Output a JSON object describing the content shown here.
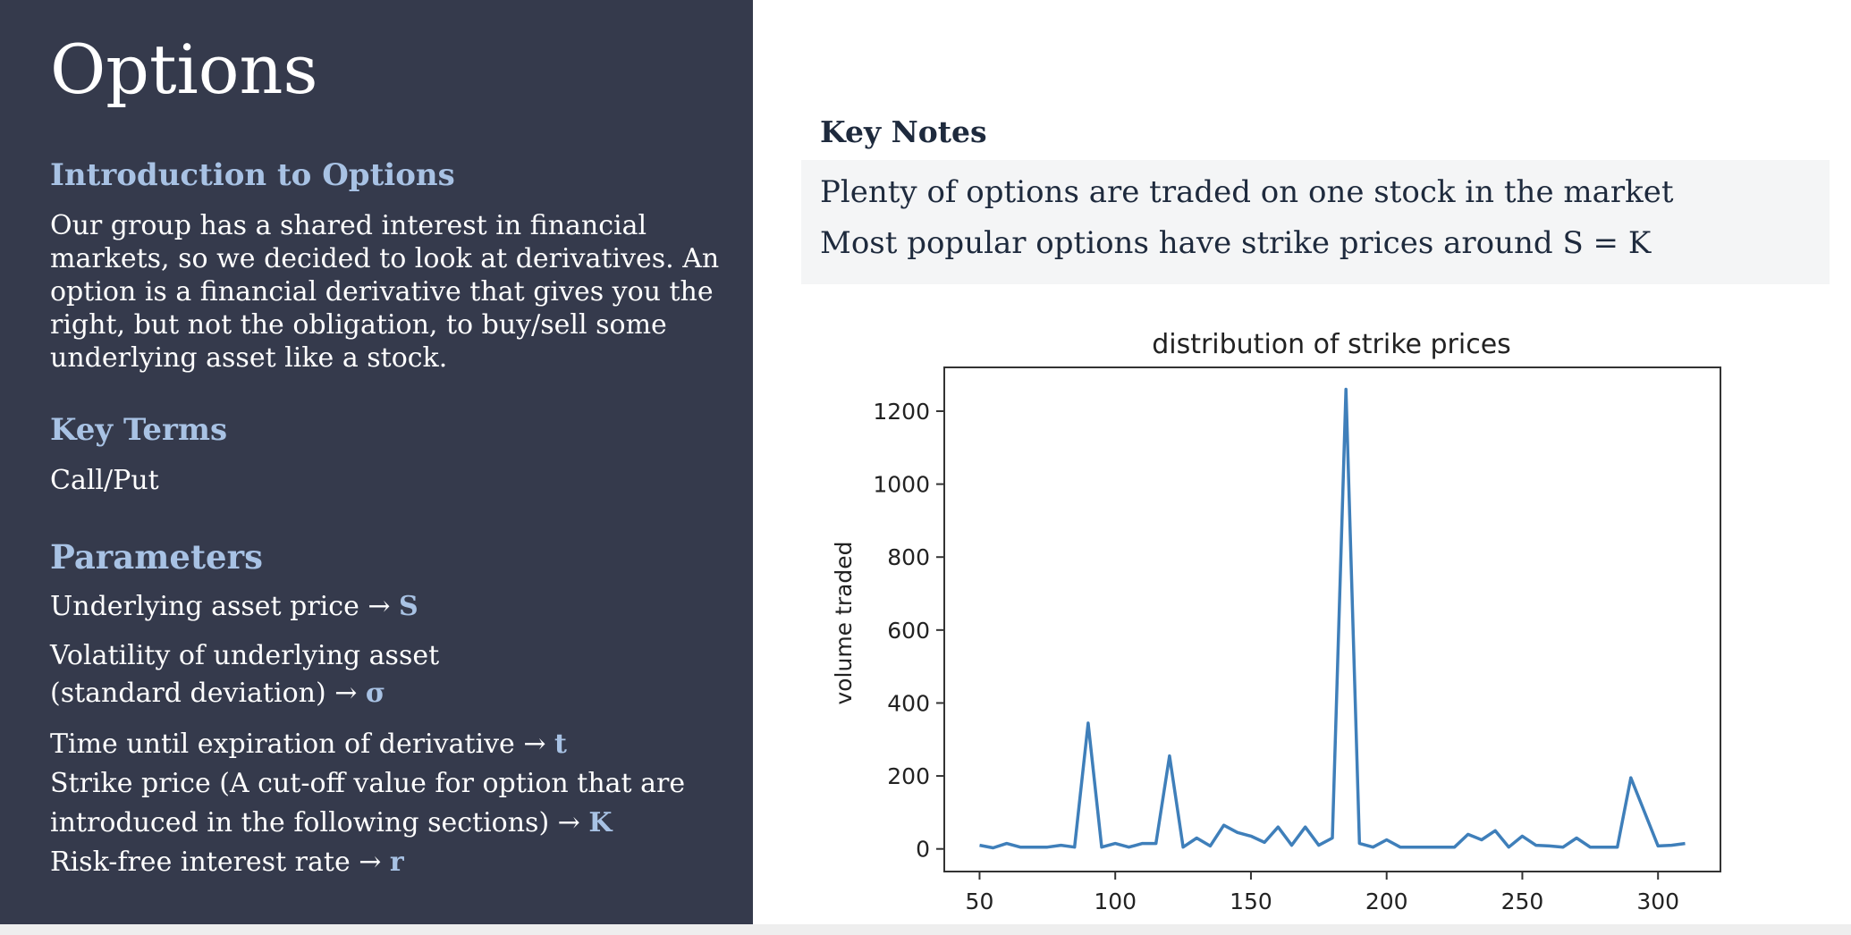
{
  "sidebar": {
    "title": "Options",
    "intro_heading": "Introduction to Options",
    "intro_lines": [
      "Our group has a shared interest in financial",
      "markets, so we decided to look at derivatives. An",
      "option is a financial derivative that gives you the",
      "right, but not the obligation, to buy/sell some",
      "underlying asset like a stock."
    ],
    "terms_heading": "Key Terms",
    "terms_text": "Call/Put",
    "params_heading": "Parameters",
    "params": {
      "p1_text": "Underlying asset price → ",
      "p1_sym": "S",
      "p2_line1": "Volatility of underlying asset",
      "p2_line2": "(standard deviation) → ",
      "p2_sym": "σ",
      "p3_text": "Time until expiration of derivative → ",
      "p3_sym": "t",
      "p4_line1": "Strike price (A cut-off value for option that are",
      "p4_line2": "introduced in the following sections) → ",
      "p4_sym": "K",
      "p5_text": "Risk-free interest rate → ",
      "p5_sym": "r"
    }
  },
  "key_notes": {
    "heading": "Key Notes",
    "notes": [
      "Plenty of options are traded on one stock in the market",
      "Most popular options have strike prices around S = K"
    ]
  },
  "colors": {
    "sidebar_bg": "#353a4c",
    "accent": "#a8c2e4",
    "line": "#3f7fba"
  },
  "chart_data": {
    "type": "line",
    "title": "distribution of strike prices",
    "xlabel": "",
    "ylabel": "volume traded",
    "xlim": [
      37,
      323
    ],
    "ylim": [
      -62,
      1320
    ],
    "xticks": [
      50,
      100,
      150,
      200,
      250,
      300
    ],
    "yticks": [
      0,
      200,
      400,
      600,
      800,
      1000,
      1200
    ],
    "grid": false,
    "x": [
      50,
      55,
      60,
      65,
      70,
      75,
      80,
      85,
      90,
      95,
      100,
      105,
      110,
      115,
      120,
      125,
      130,
      135,
      140,
      145,
      150,
      155,
      160,
      165,
      170,
      175,
      180,
      185,
      190,
      195,
      200,
      205,
      210,
      215,
      220,
      225,
      230,
      235,
      240,
      245,
      250,
      255,
      260,
      265,
      270,
      275,
      280,
      285,
      290,
      300,
      305,
      310
    ],
    "y": [
      10,
      3,
      15,
      5,
      5,
      5,
      10,
      5,
      345,
      5,
      15,
      5,
      15,
      15,
      255,
      5,
      30,
      8,
      65,
      45,
      35,
      18,
      60,
      10,
      60,
      10,
      30,
      1260,
      15,
      5,
      25,
      5,
      5,
      5,
      5,
      5,
      40,
      25,
      50,
      5,
      35,
      10,
      8,
      5,
      30,
      5,
      5,
      5,
      195,
      8,
      10,
      15
    ]
  }
}
